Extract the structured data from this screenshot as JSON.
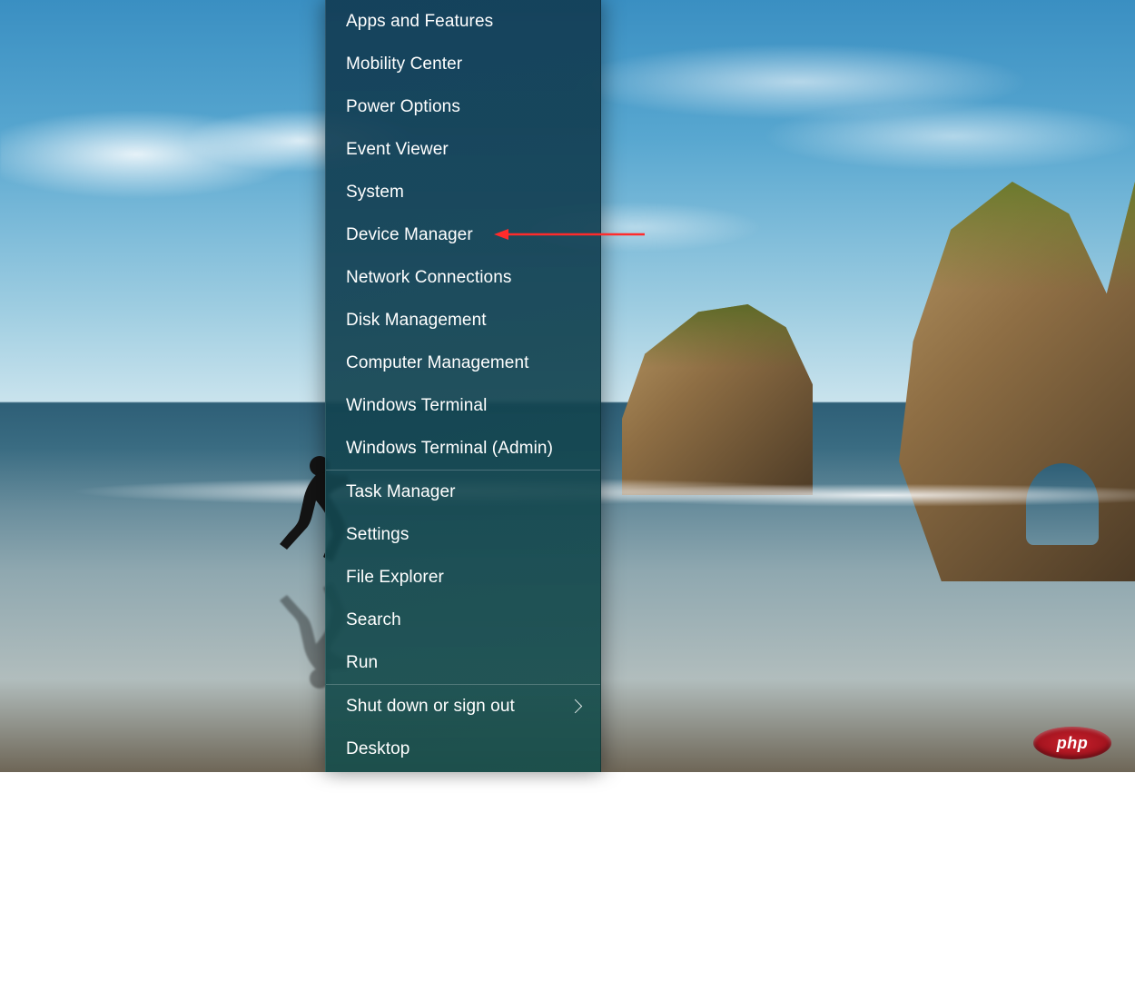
{
  "menu": {
    "groups": [
      [
        {
          "id": "apps-and-features",
          "label": "Apps and Features"
        },
        {
          "id": "mobility-center",
          "label": "Mobility Center"
        },
        {
          "id": "power-options",
          "label": "Power Options"
        },
        {
          "id": "event-viewer",
          "label": "Event Viewer"
        },
        {
          "id": "system",
          "label": "System"
        },
        {
          "id": "device-manager",
          "label": "Device Manager",
          "annotated": true
        },
        {
          "id": "network-connections",
          "label": "Network Connections"
        },
        {
          "id": "disk-management",
          "label": "Disk Management"
        },
        {
          "id": "computer-management",
          "label": "Computer Management"
        },
        {
          "id": "windows-terminal",
          "label": "Windows Terminal"
        },
        {
          "id": "windows-terminal-admin",
          "label": "Windows Terminal (Admin)"
        }
      ],
      [
        {
          "id": "task-manager",
          "label": "Task Manager"
        },
        {
          "id": "settings",
          "label": "Settings"
        },
        {
          "id": "file-explorer",
          "label": "File Explorer"
        },
        {
          "id": "search",
          "label": "Search"
        },
        {
          "id": "run",
          "label": "Run"
        }
      ],
      [
        {
          "id": "shut-down-or-sign-out",
          "label": "Shut down or sign out",
          "submenu": true
        },
        {
          "id": "desktop",
          "label": "Desktop"
        }
      ]
    ]
  },
  "annotation": {
    "target_id": "device-manager",
    "color": "#ff2b2b"
  },
  "watermark": {
    "text": "php"
  }
}
